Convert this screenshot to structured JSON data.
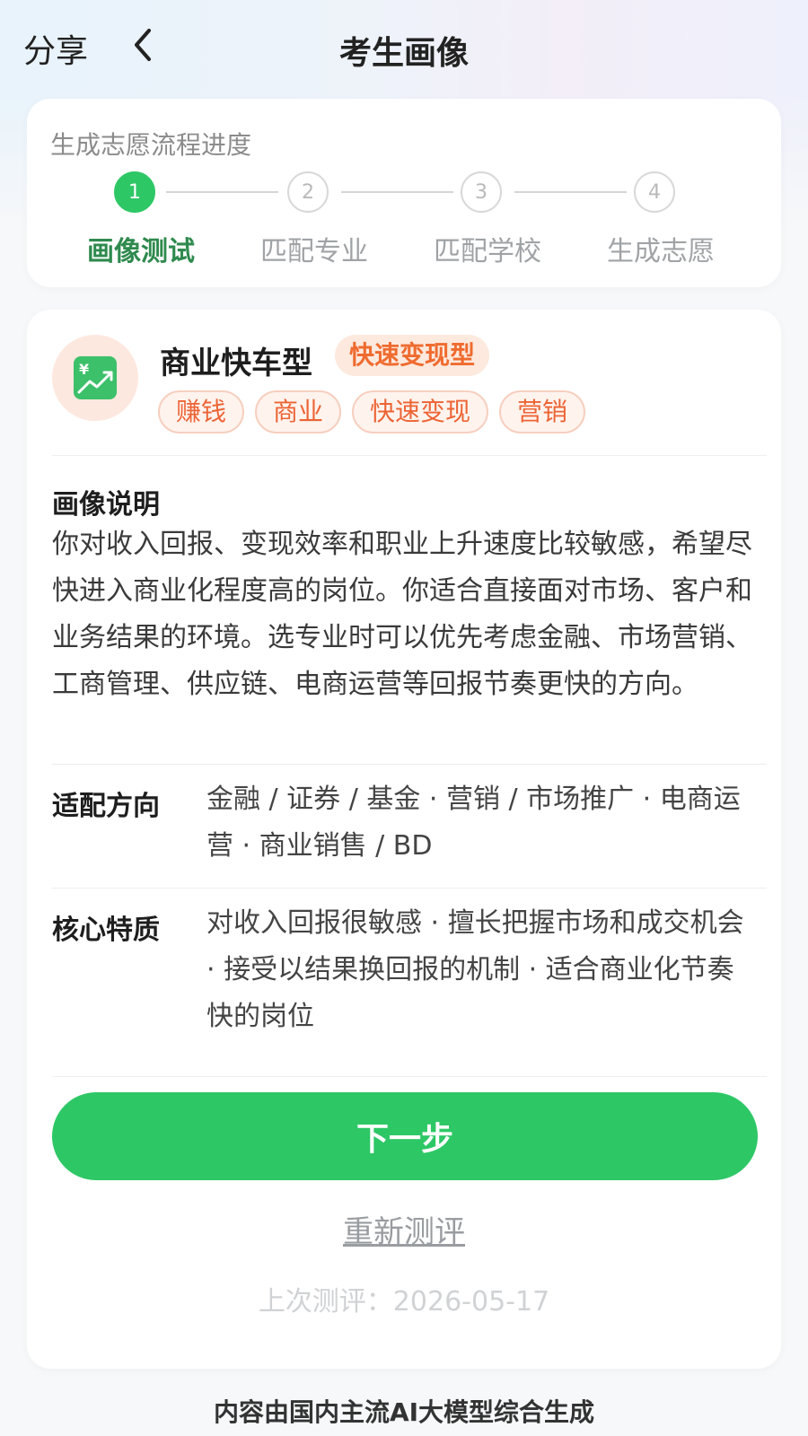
{
  "header": {
    "share_label": "分享",
    "title": "考生画像"
  },
  "progress": {
    "title": "生成志愿流程进度",
    "steps": [
      {
        "number": "1",
        "label": "画像测试",
        "active": true
      },
      {
        "number": "2",
        "label": "匹配专业",
        "active": false
      },
      {
        "number": "3",
        "label": "匹配学校",
        "active": false
      },
      {
        "number": "4",
        "label": "生成志愿",
        "active": false
      }
    ]
  },
  "profile": {
    "icon": "money-growth-icon",
    "type_name": "商业快车型",
    "type_tag": "快速变现型",
    "keywords": [
      "赚钱",
      "商业",
      "快速变现",
      "营销"
    ],
    "description_title": "画像说明",
    "description": "你对收入回报、变现效率和职业上升速度比较敏感，希望尽快进入商业化程度高的岗位。你适合直接面对市场、客户和业务结果的环境。选专业时可以优先考虑金融、市场营销、工商管理、供应链、电商运营等回报节奏更快的方向。",
    "direction_label": "适配方向",
    "direction_value": "金融 / 证券 / 基金 · 营销 / 市场推广 · 电商运营 · 商业销售 / BD",
    "traits_label": "核心特质",
    "traits_value": "对收入回报很敏感 · 擅长把握市场和成交机会 · 接受以结果换回报的机制 · 适合商业化节奏快的岗位"
  },
  "actions": {
    "next_label": "下一步",
    "retest_label": "重新测评",
    "last_test": "上次测评：2026-05-17"
  },
  "footer": {
    "text": "内容由国内主流AI大模型综合生成"
  },
  "colors": {
    "accent_green": "#2ec766",
    "tag_orange": "#ec6434"
  }
}
